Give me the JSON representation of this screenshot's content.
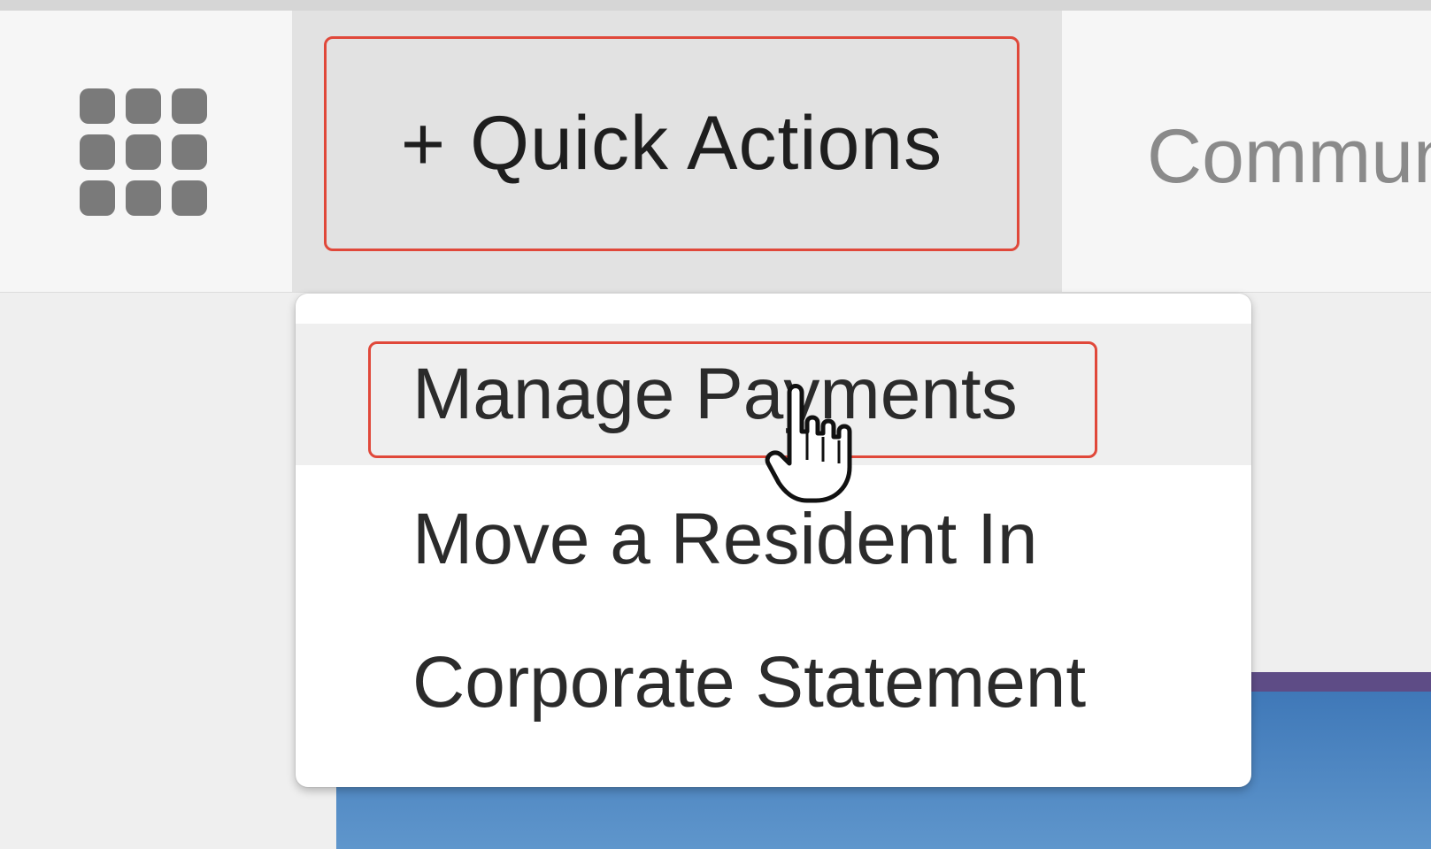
{
  "header": {
    "app_launcher_icon": "grid-icon",
    "quick_actions": {
      "icon": "plus-icon",
      "plus_glyph": "+",
      "label": "Quick Actions"
    },
    "next_nav_label": "Commun"
  },
  "dropdown": {
    "items": [
      {
        "label": "Manage Payments",
        "active": true
      },
      {
        "label": "Move a Resident In",
        "active": false
      },
      {
        "label": "Corporate Statement",
        "active": false
      }
    ]
  },
  "colors": {
    "highlight": "#e0483a",
    "active_item_bg": "#efefef",
    "tab_bg": "#e2e2e2"
  },
  "cursor": {
    "icon": "hand-pointer-icon"
  }
}
